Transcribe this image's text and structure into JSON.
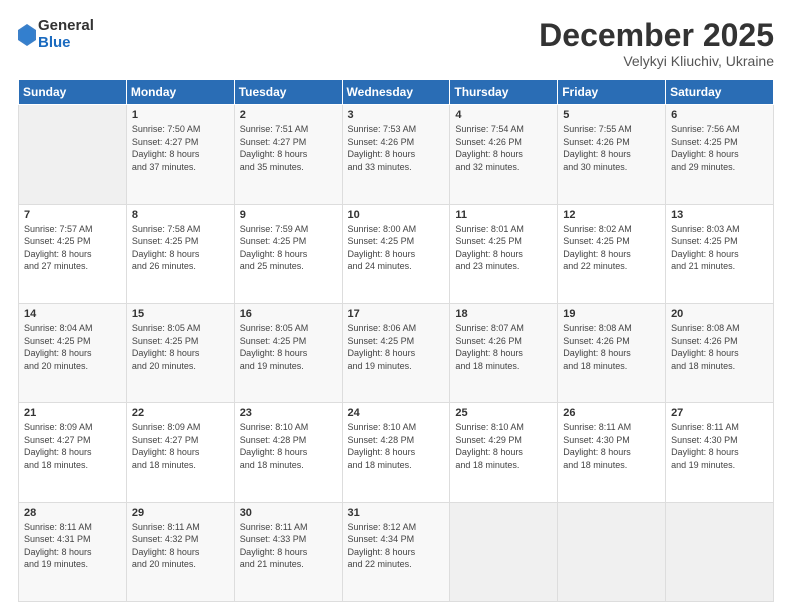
{
  "logo": {
    "general": "General",
    "blue": "Blue"
  },
  "title": "December 2025",
  "subtitle": "Velykyi Kliuchiv, Ukraine",
  "weekdays": [
    "Sunday",
    "Monday",
    "Tuesday",
    "Wednesday",
    "Thursday",
    "Friday",
    "Saturday"
  ],
  "weeks": [
    [
      {
        "day": "",
        "info": ""
      },
      {
        "day": "1",
        "info": "Sunrise: 7:50 AM\nSunset: 4:27 PM\nDaylight: 8 hours\nand 37 minutes."
      },
      {
        "day": "2",
        "info": "Sunrise: 7:51 AM\nSunset: 4:27 PM\nDaylight: 8 hours\nand 35 minutes."
      },
      {
        "day": "3",
        "info": "Sunrise: 7:53 AM\nSunset: 4:26 PM\nDaylight: 8 hours\nand 33 minutes."
      },
      {
        "day": "4",
        "info": "Sunrise: 7:54 AM\nSunset: 4:26 PM\nDaylight: 8 hours\nand 32 minutes."
      },
      {
        "day": "5",
        "info": "Sunrise: 7:55 AM\nSunset: 4:26 PM\nDaylight: 8 hours\nand 30 minutes."
      },
      {
        "day": "6",
        "info": "Sunrise: 7:56 AM\nSunset: 4:25 PM\nDaylight: 8 hours\nand 29 minutes."
      }
    ],
    [
      {
        "day": "7",
        "info": "Sunrise: 7:57 AM\nSunset: 4:25 PM\nDaylight: 8 hours\nand 27 minutes."
      },
      {
        "day": "8",
        "info": "Sunrise: 7:58 AM\nSunset: 4:25 PM\nDaylight: 8 hours\nand 26 minutes."
      },
      {
        "day": "9",
        "info": "Sunrise: 7:59 AM\nSunset: 4:25 PM\nDaylight: 8 hours\nand 25 minutes."
      },
      {
        "day": "10",
        "info": "Sunrise: 8:00 AM\nSunset: 4:25 PM\nDaylight: 8 hours\nand 24 minutes."
      },
      {
        "day": "11",
        "info": "Sunrise: 8:01 AM\nSunset: 4:25 PM\nDaylight: 8 hours\nand 23 minutes."
      },
      {
        "day": "12",
        "info": "Sunrise: 8:02 AM\nSunset: 4:25 PM\nDaylight: 8 hours\nand 22 minutes."
      },
      {
        "day": "13",
        "info": "Sunrise: 8:03 AM\nSunset: 4:25 PM\nDaylight: 8 hours\nand 21 minutes."
      }
    ],
    [
      {
        "day": "14",
        "info": "Sunrise: 8:04 AM\nSunset: 4:25 PM\nDaylight: 8 hours\nand 20 minutes."
      },
      {
        "day": "15",
        "info": "Sunrise: 8:05 AM\nSunset: 4:25 PM\nDaylight: 8 hours\nand 20 minutes."
      },
      {
        "day": "16",
        "info": "Sunrise: 8:05 AM\nSunset: 4:25 PM\nDaylight: 8 hours\nand 19 minutes."
      },
      {
        "day": "17",
        "info": "Sunrise: 8:06 AM\nSunset: 4:25 PM\nDaylight: 8 hours\nand 19 minutes."
      },
      {
        "day": "18",
        "info": "Sunrise: 8:07 AM\nSunset: 4:26 PM\nDaylight: 8 hours\nand 18 minutes."
      },
      {
        "day": "19",
        "info": "Sunrise: 8:08 AM\nSunset: 4:26 PM\nDaylight: 8 hours\nand 18 minutes."
      },
      {
        "day": "20",
        "info": "Sunrise: 8:08 AM\nSunset: 4:26 PM\nDaylight: 8 hours\nand 18 minutes."
      }
    ],
    [
      {
        "day": "21",
        "info": "Sunrise: 8:09 AM\nSunset: 4:27 PM\nDaylight: 8 hours\nand 18 minutes."
      },
      {
        "day": "22",
        "info": "Sunrise: 8:09 AM\nSunset: 4:27 PM\nDaylight: 8 hours\nand 18 minutes."
      },
      {
        "day": "23",
        "info": "Sunrise: 8:10 AM\nSunset: 4:28 PM\nDaylight: 8 hours\nand 18 minutes."
      },
      {
        "day": "24",
        "info": "Sunrise: 8:10 AM\nSunset: 4:28 PM\nDaylight: 8 hours\nand 18 minutes."
      },
      {
        "day": "25",
        "info": "Sunrise: 8:10 AM\nSunset: 4:29 PM\nDaylight: 8 hours\nand 18 minutes."
      },
      {
        "day": "26",
        "info": "Sunrise: 8:11 AM\nSunset: 4:30 PM\nDaylight: 8 hours\nand 18 minutes."
      },
      {
        "day": "27",
        "info": "Sunrise: 8:11 AM\nSunset: 4:30 PM\nDaylight: 8 hours\nand 19 minutes."
      }
    ],
    [
      {
        "day": "28",
        "info": "Sunrise: 8:11 AM\nSunset: 4:31 PM\nDaylight: 8 hours\nand 19 minutes."
      },
      {
        "day": "29",
        "info": "Sunrise: 8:11 AM\nSunset: 4:32 PM\nDaylight: 8 hours\nand 20 minutes."
      },
      {
        "day": "30",
        "info": "Sunrise: 8:11 AM\nSunset: 4:33 PM\nDaylight: 8 hours\nand 21 minutes."
      },
      {
        "day": "31",
        "info": "Sunrise: 8:12 AM\nSunset: 4:34 PM\nDaylight: 8 hours\nand 22 minutes."
      },
      {
        "day": "",
        "info": ""
      },
      {
        "day": "",
        "info": ""
      },
      {
        "day": "",
        "info": ""
      }
    ]
  ]
}
